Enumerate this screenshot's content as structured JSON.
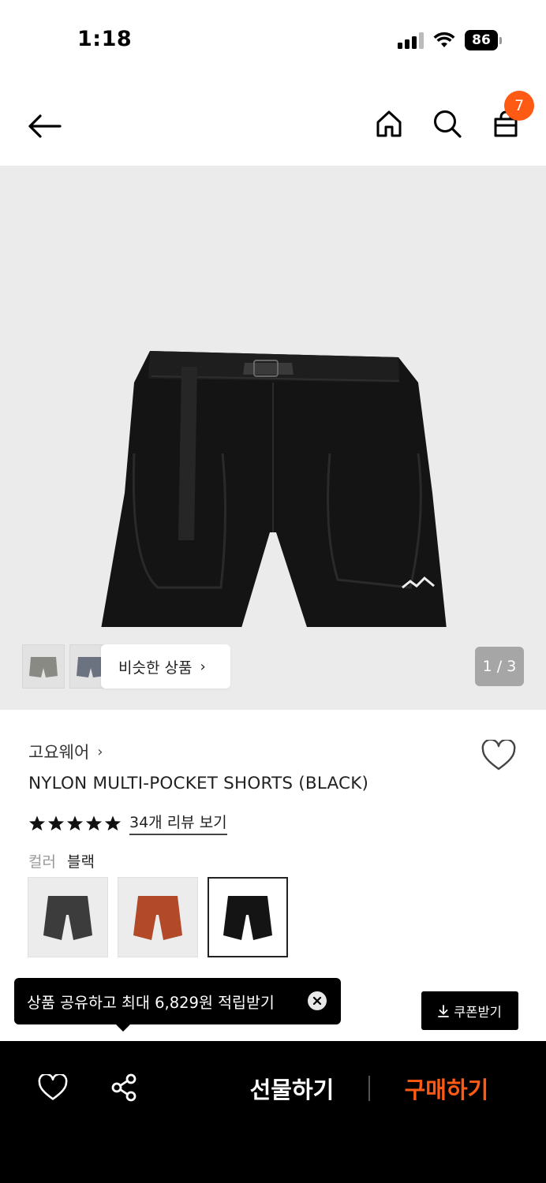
{
  "status_bar": {
    "time": "1:18",
    "battery": "86"
  },
  "nav": {
    "cart_count": "7"
  },
  "hero": {
    "similar_label": "비슷한 상품",
    "page_indicator": "1 / 3"
  },
  "product": {
    "brand": "고요웨어",
    "name": "NYLON MULTI-POCKET SHORTS (BLACK)",
    "rating_stars": 5,
    "review_link": "34개 리뷰 보기",
    "color_label": "컬러",
    "color_value": "블랙"
  },
  "colors": {
    "accent": "#ff5a13",
    "bar": "#000000"
  },
  "tooltip": {
    "text": "상품 공유하고 최대 6,829원 적립받기"
  },
  "coupon": {
    "label": "쿠폰받기"
  },
  "bottom_bar": {
    "gift_label": "선물하기",
    "buy_label": "구매하기"
  }
}
